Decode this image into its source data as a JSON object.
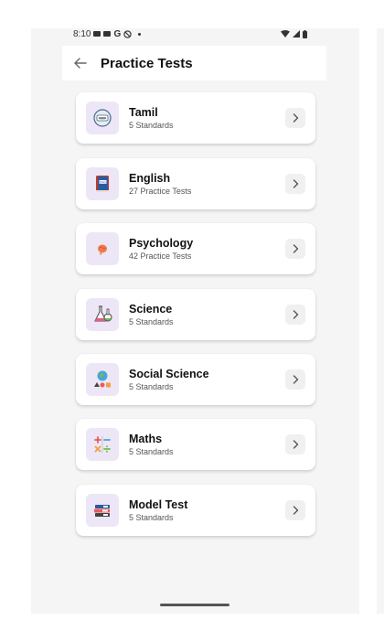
{
  "status_bar": {
    "time": "8:10",
    "g_label": "G"
  },
  "app_bar": {
    "title": "Practice Tests",
    "back_icon": "arrow-left-icon"
  },
  "subjects": [
    {
      "title": "Tamil",
      "subtitle": "5 Standards",
      "icon": "tamil-book-icon"
    },
    {
      "title": "English",
      "subtitle": "27 Practice Tests",
      "icon": "english-book-icon"
    },
    {
      "title": "Psychology",
      "subtitle": "42 Practice Tests",
      "icon": "brain-icon"
    },
    {
      "title": "Science",
      "subtitle": "5 Standards",
      "icon": "flask-icon"
    },
    {
      "title": "Social Science",
      "subtitle": "5 Standards",
      "icon": "globe-shapes-icon"
    },
    {
      "title": "Maths",
      "subtitle": "5 Standards",
      "icon": "math-symbols-icon"
    },
    {
      "title": "Model Test",
      "subtitle": "5 Standards",
      "icon": "stacked-books-icon"
    }
  ]
}
